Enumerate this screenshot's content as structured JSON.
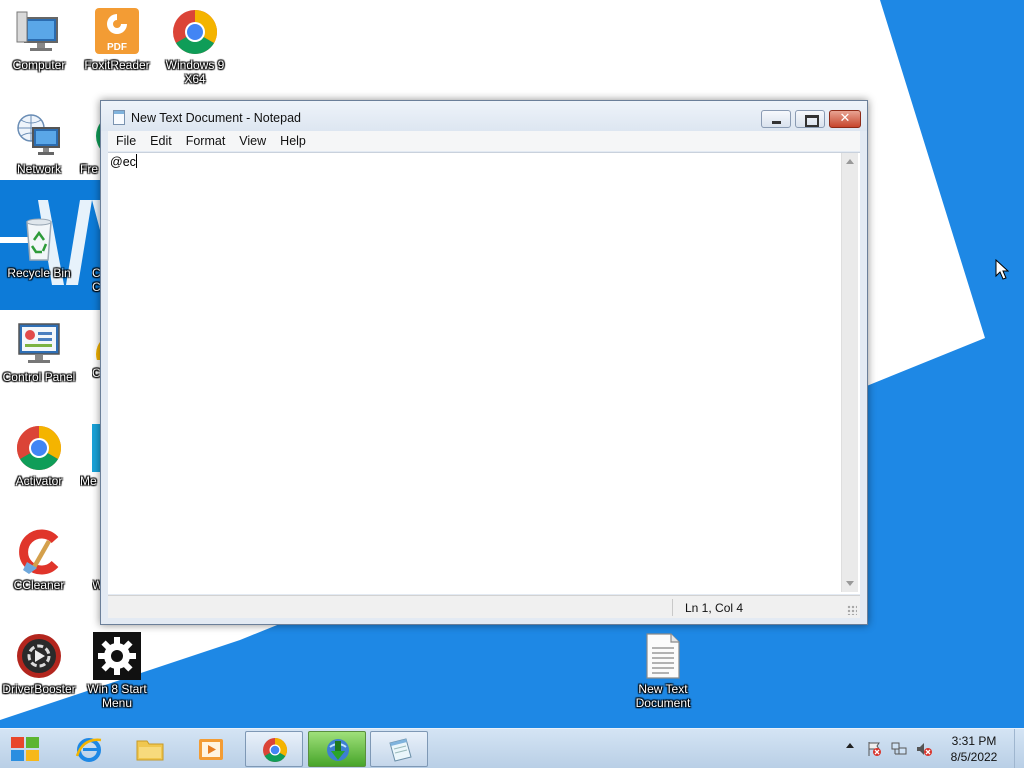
{
  "desktop": {
    "icons": [
      {
        "label": "Computer",
        "icon": "computer-icon"
      },
      {
        "label": "FoxitReader",
        "icon": "foxit-pdf-icon",
        "badge": "PDF"
      },
      {
        "label": "Windows 9 X64",
        "icon": "chrome-icon"
      },
      {
        "label": "Network",
        "icon": "network-icon"
      },
      {
        "label": "Recycle Bin",
        "icon": "recycle-bin-icon"
      },
      {
        "label": "Control Panel",
        "icon": "control-panel-icon"
      },
      {
        "label": "Activator",
        "icon": "chrome-icon"
      },
      {
        "label": "CCleaner",
        "icon": "ccleaner-icon"
      },
      {
        "label": "DriverBooster",
        "icon": "driverbooster-icon"
      },
      {
        "label": "Win 8 Start Menu",
        "icon": "gear-icon"
      },
      {
        "label": "New Text Document",
        "icon": "text-document-icon"
      }
    ],
    "partial_labels": [
      "Fre",
      "C",
      "C",
      "C",
      "Me",
      "W"
    ]
  },
  "notepad": {
    "title": "New Text Document - Notepad",
    "menu": [
      "File",
      "Edit",
      "Format",
      "View",
      "Help"
    ],
    "content": "@ec",
    "status": "Ln 1, Col 4"
  },
  "taskbar": {
    "items": [
      {
        "name": "internet-explorer",
        "icon": "ie-icon"
      },
      {
        "name": "file-explorer",
        "icon": "folder-icon"
      },
      {
        "name": "media-player",
        "icon": "media-player-icon"
      },
      {
        "name": "chrome",
        "icon": "chrome-icon"
      },
      {
        "name": "internet-download-manager",
        "icon": "idm-icon"
      },
      {
        "name": "notepad",
        "icon": "notepad-icon"
      }
    ],
    "clock": {
      "time": "3:31 PM",
      "date": "8/5/2022"
    }
  },
  "colors": {
    "wallpaper_blue": "#1e88e5",
    "wallpaper_white": "#ffffff",
    "close_button": "#c7452c"
  }
}
